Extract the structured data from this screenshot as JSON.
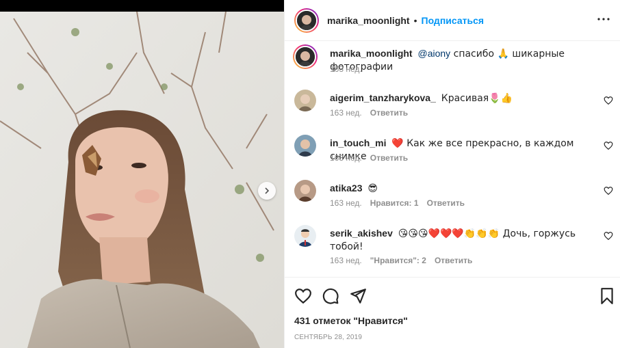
{
  "post": {
    "author": "marika_moonlight",
    "follow_label": "Подписаться",
    "separator": "•",
    "caption": {
      "mention": "@aiony",
      "text": " спасибо 🙏 шикарные фотографии",
      "time": "163 нед."
    },
    "likes": "431 отметок \"Нравится\"",
    "date": "СЕНТЯБРЬ 28, 2019"
  },
  "comments": [
    {
      "user": "aigerim_tanzharykova_",
      "text": "Красивая🌷👍",
      "time": "163 нед.",
      "likes": "",
      "reply": "Ответить",
      "avatar_color": "#c9b89a"
    },
    {
      "user": "in_touch_mi",
      "text": "❤️ Как же все прекрасно, в каждом снимке",
      "time": "163 нед.",
      "likes": "",
      "reply": "Ответить",
      "avatar_color": "#7f9fb5"
    },
    {
      "user": "atika23",
      "text": "😎",
      "time": "163 нед.",
      "likes": "Нравится: 1",
      "reply": "Ответить",
      "avatar_color": "#b79a86"
    },
    {
      "user": "serik_akishev",
      "text": "😘😘😘❤️❤️❤️👏👏👏 Дочь, горжусь тобой!",
      "time": "163 нед.",
      "likes": "\"Нравится\": 2",
      "reply": "Ответить",
      "avatar_color": "#e8eef2"
    }
  ],
  "icons": {
    "like": "heart-icon",
    "comment": "comment-icon",
    "share": "paper-plane-icon",
    "save": "bookmark-icon",
    "more": "more-horizontal-icon",
    "next": "chevron-right-icon"
  },
  "colors": {
    "link": "#0095f6",
    "mention": "#00376b",
    "muted": "#8e8e8e",
    "text": "#262626"
  }
}
